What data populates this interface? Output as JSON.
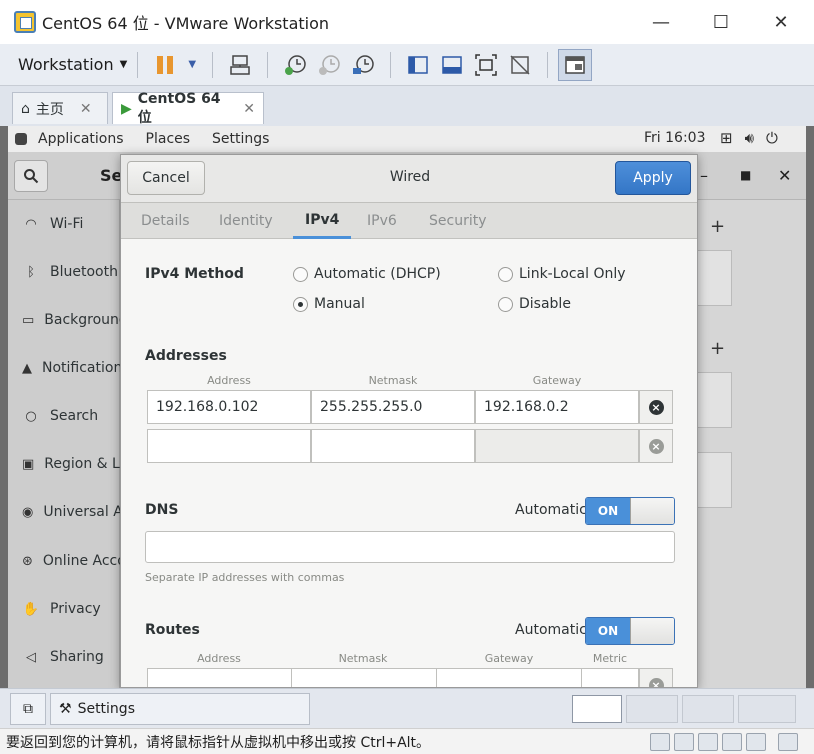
{
  "vmware": {
    "window_title": "CentOS 64 位 - VMware Workstation",
    "menu_label": "Workstation",
    "tabs": [
      {
        "label": "主页"
      },
      {
        "label": "CentOS 64 位"
      }
    ],
    "task_label": "Settings",
    "status_text": "要返回到您的计算机，请将鼠标指针从虚拟机中移出或按 Ctrl+Alt。"
  },
  "gnome": {
    "topbar": {
      "menus": [
        "Applications",
        "Places",
        "Settings"
      ],
      "clock": "Fri 16:03"
    },
    "settings": {
      "header_title": "Se",
      "sidebar": [
        {
          "label": "Wi-Fi",
          "icon": "wifi-icon"
        },
        {
          "label": "Bluetooth",
          "icon": "bluetooth-icon"
        },
        {
          "label": "Background",
          "icon": "background-icon"
        },
        {
          "label": "Notifications",
          "icon": "bell-icon"
        },
        {
          "label": "Search",
          "icon": "search-icon"
        },
        {
          "label": "Region & Language",
          "icon": "region-icon"
        },
        {
          "label": "Universal Access",
          "icon": "accessibility-icon"
        },
        {
          "label": "Online Accounts",
          "icon": "online-accounts-icon"
        },
        {
          "label": "Privacy",
          "icon": "privacy-icon"
        },
        {
          "label": "Sharing",
          "icon": "sharing-icon"
        }
      ]
    }
  },
  "dialog": {
    "title": "Wired",
    "cancel_label": "Cancel",
    "apply_label": "Apply",
    "tabs": [
      "Details",
      "Identity",
      "IPv4",
      "IPv6",
      "Security"
    ],
    "active_tab": "IPv4",
    "ipv4_method_label": "IPv4 Method",
    "methods": {
      "auto": "Automatic (DHCP)",
      "link_local": "Link-Local Only",
      "manual": "Manual",
      "disable": "Disable"
    },
    "selected_method": "Manual",
    "addresses_label": "Addresses",
    "addr_columns": [
      "Address",
      "Netmask",
      "Gateway"
    ],
    "addresses": [
      {
        "address": "192.168.0.102",
        "netmask": "255.255.255.0",
        "gateway": "192.168.0.2"
      },
      {
        "address": "",
        "netmask": "",
        "gateway": ""
      }
    ],
    "dns_label": "DNS",
    "automatic_label": "Automatic",
    "switch_on_label": "ON",
    "dns_value": "",
    "dns_hint": "Separate IP addresses with commas",
    "routes_label": "Routes",
    "route_columns": [
      "Address",
      "Netmask",
      "Gateway",
      "Metric"
    ]
  },
  "colors": {
    "accent": "#4a90d9",
    "apply_button": "#3476c6"
  }
}
